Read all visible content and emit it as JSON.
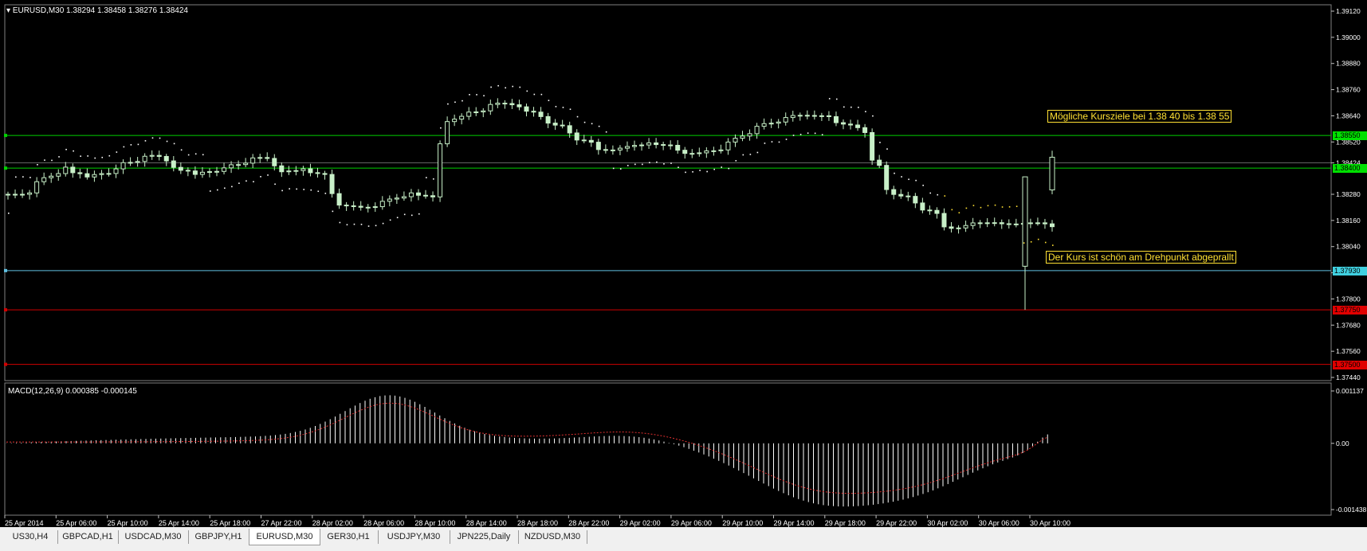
{
  "symbol_header": "EURUSD,M30  1.38294 1.38458 1.38276 1.38424",
  "macd_header": "MACD(12,26,9) 0.000385 -0.000145",
  "price_axis": {
    "ticks": [
      "1.39120",
      "1.39000",
      "1.38880",
      "1.38760",
      "1.38640",
      "1.38520",
      "1.38424",
      "1.38280",
      "1.38160",
      "1.38040",
      "1.37920",
      "1.37800",
      "1.37680",
      "1.37560",
      "1.37440"
    ]
  },
  "macd_axis": {
    "ticks": [
      "0.001137",
      "0.00",
      "-0.001438"
    ]
  },
  "time_axis": {
    "ticks": [
      "25 Apr 2014",
      "25 Apr 06:00",
      "25 Apr 10:00",
      "25 Apr 14:00",
      "25 Apr 18:00",
      "27 Apr 22:00",
      "28 Apr 02:00",
      "28 Apr 06:00",
      "28 Apr 10:00",
      "28 Apr 14:00",
      "28 Apr 18:00",
      "28 Apr 22:00",
      "29 Apr 02:00",
      "29 Apr 06:00",
      "29 Apr 10:00",
      "29 Apr 14:00",
      "29 Apr 18:00",
      "29 Apr 22:00",
      "30 Apr 02:00",
      "30 Apr 06:00",
      "30 Apr 10:00"
    ]
  },
  "price_tags": [
    {
      "label": "1.38550",
      "bg": "#00e000"
    },
    {
      "label": "1.38400",
      "bg": "#00e000"
    },
    {
      "label": "1.37930",
      "bg": "#40d0e0"
    },
    {
      "label": "1.37750",
      "bg": "#e00000"
    },
    {
      "label": "1.37500",
      "bg": "#e00000"
    }
  ],
  "annotations": {
    "targets": "Mögliche Kursziele bei 1.38 40 bis 1.38 55",
    "pivot": "Der Kurs ist schön am Drehpunkt abgeprallt"
  },
  "tabs": [
    {
      "label": "US30,H4",
      "active": false
    },
    {
      "label": "GBPCAD,H1",
      "active": false
    },
    {
      "label": "USDCAD,M30",
      "active": false
    },
    {
      "label": "GBPJPY,H1",
      "active": false
    },
    {
      "label": "EURUSD,M30",
      "active": true
    },
    {
      "label": "GER30,H1",
      "active": false
    },
    {
      "label": "USDJPY,M30",
      "active": false
    },
    {
      "label": "JPN225,Daily",
      "active": false
    },
    {
      "label": "NZDUSD,M30",
      "active": false
    }
  ],
  "colors": {
    "candle": "#c8f0c8",
    "sar": "#ffffff",
    "resistance": "#00d000",
    "pivot": "#60c0e0",
    "support": "#d00000",
    "annotation": "#ffe033",
    "macd_histogram": "#ffffff",
    "macd_signal": "#e03030"
  },
  "chart_data": {
    "type": "candlestick",
    "price_range": [
      1.3744,
      1.3912
    ],
    "horizontal_levels": [
      1.3855,
      1.384,
      1.3793,
      1.3775,
      1.375
    ],
    "approx_closes": [
      1.3828,
      1.3836,
      1.3841,
      1.3834,
      1.3838,
      1.3843,
      1.3846,
      1.384,
      1.3836,
      1.3839,
      1.3842,
      1.3845,
      1.3838,
      1.384,
      1.3836,
      1.382,
      1.3822,
      1.3826,
      1.3829,
      1.3826,
      1.3872,
      1.3866,
      1.387,
      1.3868,
      1.3862,
      1.3858,
      1.3852,
      1.3848,
      1.385,
      1.3852,
      1.385,
      1.3846,
      1.3848,
      1.3854,
      1.386,
      1.3862,
      1.3865,
      1.3864,
      1.386,
      1.3856,
      1.382,
      1.3826,
      1.382,
      1.3812,
      1.3815,
      1.3815,
      1.3814,
      1.3815,
      1.3813,
      1.3812,
      1.381,
      1.3808,
      1.3807,
      1.3803,
      1.38,
      1.3808,
      1.383,
      1.3842
    ]
  }
}
